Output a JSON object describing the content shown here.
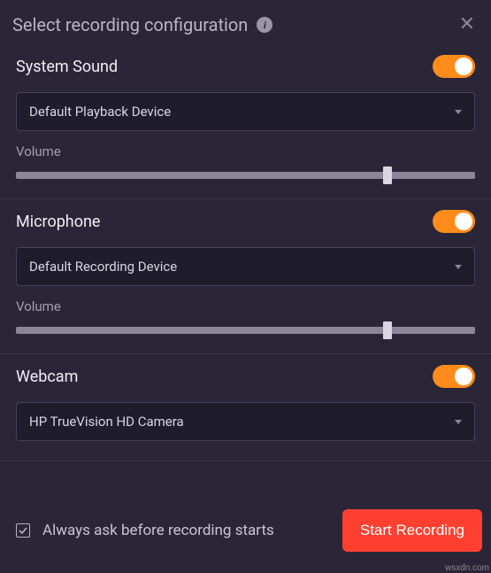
{
  "header": {
    "title": "Select recording configuration"
  },
  "systemSound": {
    "title": "System Sound",
    "enabled": true,
    "device": "Default Playback Device",
    "volumeLabel": "Volume",
    "volume": 80
  },
  "microphone": {
    "title": "Microphone",
    "enabled": true,
    "device": "Default Recording Device",
    "volumeLabel": "Volume",
    "volume": 80
  },
  "webcam": {
    "title": "Webcam",
    "enabled": true,
    "device": "HP TrueVision HD Camera"
  },
  "footer": {
    "checkboxLabel": "Always ask before recording starts",
    "checked": true,
    "startButton": "Start Recording"
  },
  "watermark": "wsxdn.com"
}
